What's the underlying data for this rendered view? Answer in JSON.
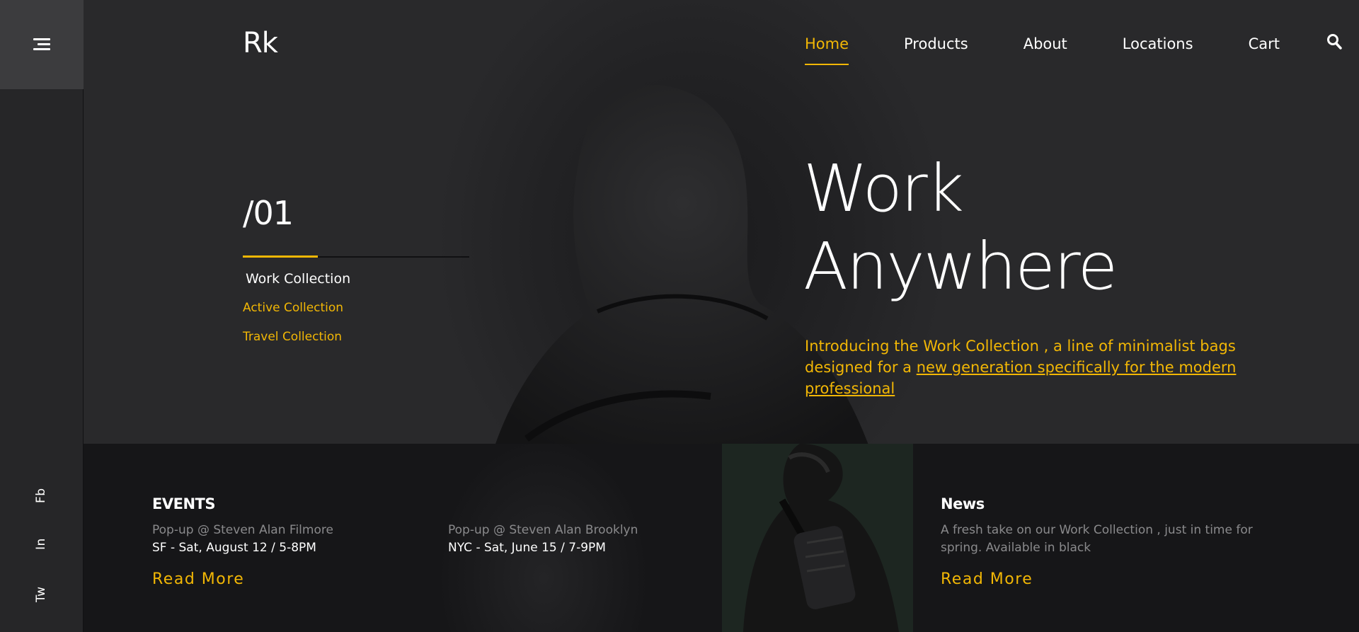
{
  "sidebar": {
    "menu_icon": "hamburger-menu-icon",
    "socials": [
      "Fb",
      "In",
      "Tw"
    ]
  },
  "header": {
    "logo": "Rk",
    "nav": [
      "Home",
      "Products",
      "About",
      "Locations",
      "Cart"
    ],
    "active_nav": "Home",
    "search_icon": "search-icon"
  },
  "hero": {
    "slide_number": "/01",
    "collections": [
      "Work Collection",
      "Active Collection",
      "Travel Collection"
    ],
    "headline_line1": "Work",
    "headline_line2": "Anywhere",
    "intro_text": "Introducing the Work Collection , a line of minimalist bags designed for a",
    "intro_link": "new generation specifically for the modern professional"
  },
  "events": {
    "title": "EVENTS",
    "items": [
      {
        "where": "Pop-up @ Steven Alan Filmore",
        "when": "SF - Sat, August 12 / 5-8PM"
      },
      {
        "where": "Pop-up @ Steven Alan Brooklyn",
        "when": "NYC - Sat, June 15 / 7-9PM"
      }
    ],
    "read_more": "Read More"
  },
  "news": {
    "title": "News",
    "text": "A fresh take on our Work Collection , just in time for spring. Available in black",
    "read_more": "Read More"
  },
  "colors": {
    "accent": "#f2b705",
    "background": "#1e1e20",
    "sidebar": "#262628",
    "menu_button": "#3c3c3e",
    "bottom_strip": "#161618"
  }
}
